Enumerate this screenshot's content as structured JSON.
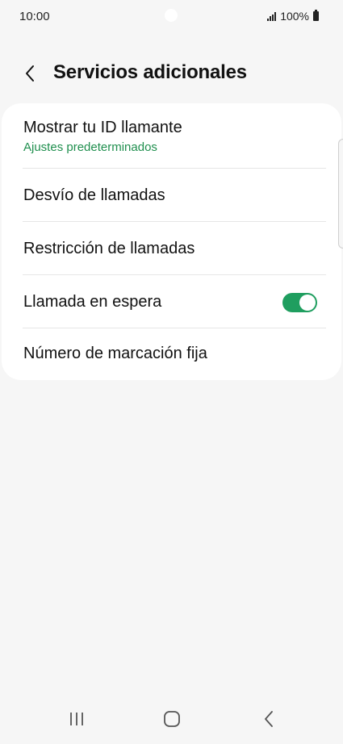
{
  "status_bar": {
    "time": "10:00",
    "battery_text": "100%",
    "icons": [
      "signal-icon",
      "battery-icon"
    ]
  },
  "header": {
    "title": "Servicios adicionales",
    "back_icon": "chevron-left-icon"
  },
  "settings": {
    "caller_id": {
      "label": "Mostrar tu ID llamante",
      "sublabel": "Ajustes predeterminados"
    },
    "call_forwarding": {
      "label": "Desvío de llamadas"
    },
    "call_barring": {
      "label": "Restricción de llamadas"
    },
    "call_waiting": {
      "label": "Llamada en espera",
      "enabled": true
    },
    "fixed_dialing": {
      "label": "Número de marcación fija"
    }
  },
  "nav_bar": {
    "icons": [
      "recent-apps-icon",
      "home-icon",
      "back-icon"
    ]
  },
  "colors": {
    "accent": "#1f9e5f",
    "sublabel": "#1f8f4e",
    "background": "#f6f6f6",
    "card": "#ffffff"
  }
}
